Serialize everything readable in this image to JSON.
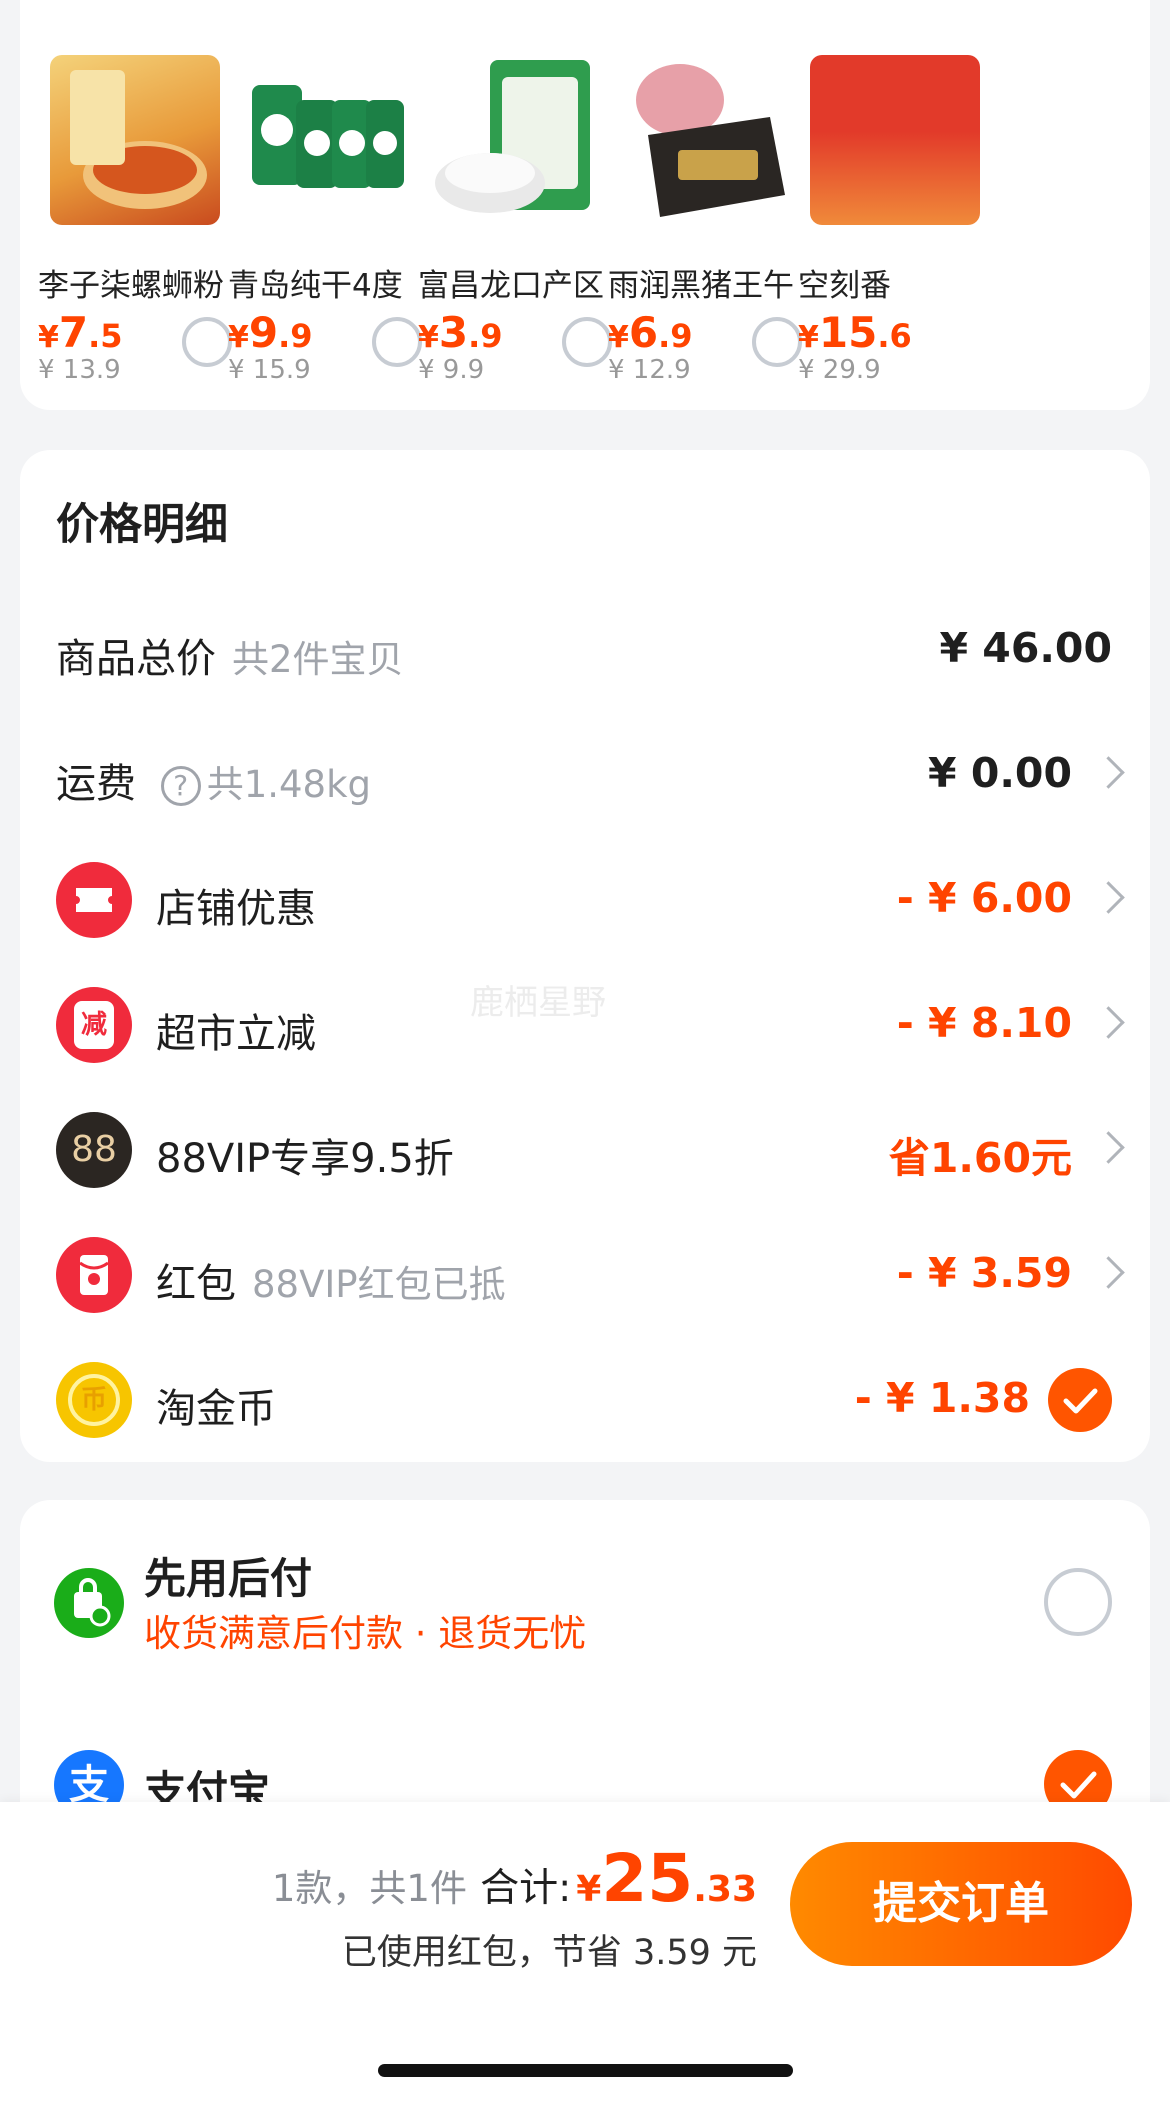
{
  "recommend": {
    "title": "",
    "products": [
      {
        "name": "李子柒螺蛳粉",
        "yen": "¥",
        "price_int": "7",
        "price_dec": ".5",
        "original": "¥ 13.9"
      },
      {
        "name": "青岛纯干4度",
        "yen": "¥",
        "price_int": "9",
        "price_dec": ".9",
        "original": "¥ 15.9"
      },
      {
        "name": "富昌龙口产区",
        "yen": "¥",
        "price_int": "3",
        "price_dec": ".9",
        "original": "¥ 9.9"
      },
      {
        "name": "雨润黑猪王午",
        "yen": "¥",
        "price_int": "6",
        "price_dec": ".9",
        "original": "¥ 12.9"
      },
      {
        "name": "空刻番",
        "yen": "¥",
        "price_int": "15",
        "price_dec": ".6",
        "original": "¥ 29.9"
      }
    ]
  },
  "price_detail": {
    "title": "价格明细",
    "items": [
      {
        "label": "商品总价",
        "sub": "共2件宝贝",
        "value": "¥ 46.00"
      },
      {
        "label": "运费",
        "sub": "共1.48kg",
        "value": "¥ 0.00"
      },
      {
        "label": "店铺优惠",
        "value": "- ¥ 6.00",
        "icon": "ticket-icon",
        "icon_color": "#f02b3c"
      },
      {
        "label": "超市立减",
        "value": "- ¥ 8.10",
        "icon": "reduce-icon",
        "icon_color": "#f02b3c",
        "icon_text": "减"
      },
      {
        "label": "88VIP专享9.5折",
        "value": "省1.60元",
        "icon": "88vip-icon",
        "icon_color": "#2b2622",
        "icon_text": "88"
      },
      {
        "label": "红包",
        "sub": "88VIP红包已抵",
        "value": "- ¥ 3.59",
        "icon": "red-packet-icon",
        "icon_color": "#f02b3c"
      },
      {
        "label": "淘金币",
        "value": "- ¥ 1.38",
        "icon": "gold-coin-icon",
        "icon_color": "#f7c500",
        "checked": true
      }
    ]
  },
  "payment": {
    "methods": [
      {
        "title": "先用后付",
        "subtitle": "收货满意后付款 · 退货无忧",
        "icon": "pay-later-icon",
        "selected": false
      },
      {
        "title": "支付宝",
        "icon": "alipay-icon",
        "selected": true
      }
    ]
  },
  "bottom_bar": {
    "count_text": "1款，共1件",
    "total_label": "合计:",
    "total_yen": "¥",
    "total_int": "25",
    "total_dec": ".33",
    "saved_text": "已使用红包，节省 3.59 元",
    "submit_label": "提交订单"
  },
  "colors": {
    "accent": "#ff4400",
    "submit_gradient_start": "#ff8a00",
    "submit_gradient_end": "#ff4a00"
  },
  "watermark": "鹿栖星野"
}
